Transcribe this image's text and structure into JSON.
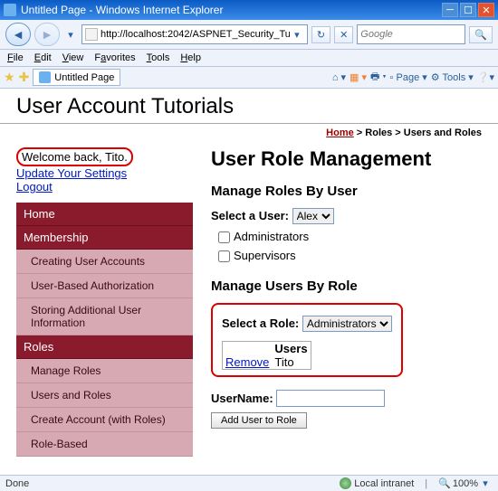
{
  "window": {
    "title": "Untitled Page - Windows Internet Explorer"
  },
  "address": {
    "url": "http://localhost:2042/ASPNET_Security_Tut"
  },
  "search": {
    "placeholder": "Google"
  },
  "menus": [
    "File",
    "Edit",
    "View",
    "Favorites",
    "Tools",
    "Help"
  ],
  "tab": {
    "title": "Untitled Page"
  },
  "favItems": {
    "home": "",
    "feeds": "",
    "print": "",
    "page": "Page",
    "tools": "Tools"
  },
  "header": {
    "title": "User Account Tutorials"
  },
  "breadcrumb": {
    "home": "Home",
    "sep1": " > ",
    "roles": "Roles",
    "sep2": " > ",
    "cur": "Users and Roles"
  },
  "welcome": "Welcome back, Tito.",
  "links": {
    "settings": "Update Your Settings",
    "logout": "Logout"
  },
  "nav": {
    "home": "Home",
    "membership": "Membership",
    "m1": "Creating User Accounts",
    "m2": "User-Based Authorization",
    "m3": "Storing Additional User Information",
    "roles": "Roles",
    "r1": "Manage Roles",
    "r2": "Users and Roles",
    "r3": "Create Account (with Roles)",
    "r4": "Role-Based"
  },
  "main": {
    "h2": "User Role Management",
    "h3a": "Manage Roles By User",
    "selectUserLabel": "Select a User:",
    "selectedUser": "Alex",
    "cbAdmin": "Administrators",
    "cbSup": "Supervisors",
    "h3b": "Manage Users By Role",
    "selectRoleLabel": "Select a Role:",
    "selectedRole": "Administrators",
    "tableHeader": "Users",
    "removeText": "Remove",
    "rowUser": "Tito",
    "userNameLabel": "UserName:",
    "addButton": "Add User to Role"
  },
  "statusbar": {
    "done": "Done",
    "zone": "Local intranet",
    "zoom": "100%"
  }
}
